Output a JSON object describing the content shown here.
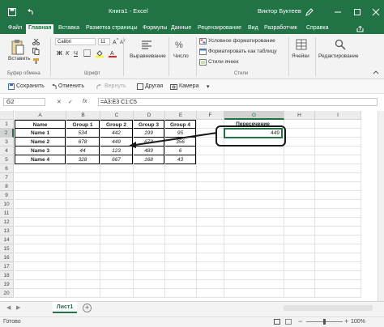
{
  "titlebar": {
    "autosave_icon": "save-icon",
    "undo_icon": "undo-icon",
    "title": "Книга1  -  Excel",
    "user": "Виктор Буктеев",
    "controls": [
      "—",
      "☐",
      "✕"
    ]
  },
  "menu": {
    "tabs": [
      "Файл",
      "Главная",
      "Вставка",
      "Разметка страницы",
      "Формулы",
      "Данные",
      "Рецензирование",
      "Вид",
      "Разработчик",
      "Справка"
    ],
    "active": "Главная"
  },
  "ribbon": {
    "paste": "Вставить",
    "font_name": "Calibri",
    "font_size": "11",
    "bold": "Ж",
    "italic": "К",
    "underline": "Ч",
    "alignment": "Выравнивание",
    "number": "Число",
    "cond_format": "Условное форматирование",
    "format_table": "Форматировать как таблицу",
    "cell_styles": "Стили ячеек",
    "cells": "Ячейки",
    "editing": "Редактирование",
    "groups": {
      "clipboard": "Буфер обмена",
      "font": "Шрифт",
      "styles": "Стили"
    }
  },
  "quick_access": {
    "save": "Сохранить",
    "undo": "Отменить",
    "redo": "Вернуть",
    "other": "Другая",
    "camera": "Камера"
  },
  "formula_bar": {
    "name_box": "G2",
    "fx": "fx",
    "formula": "=A3:E3 C1:C5"
  },
  "grid": {
    "columns": [
      "A",
      "B",
      "C",
      "D",
      "E",
      "F",
      "G",
      "H",
      "I"
    ],
    "rows": [
      "1",
      "2",
      "3",
      "4",
      "5",
      "6",
      "7",
      "8",
      "9",
      "10",
      "11",
      "12",
      "13",
      "14",
      "15",
      "16",
      "17",
      "18",
      "19",
      "20"
    ],
    "table": {
      "headers": [
        "Name",
        "Group 1",
        "Group 2",
        "Group 3",
        "Group 4"
      ],
      "rows": [
        [
          "Name 1",
          "534",
          "442",
          "199",
          "95"
        ],
        [
          "Name 2",
          "678",
          "449",
          "673",
          "356"
        ],
        [
          "Name 3",
          "44",
          "123",
          "489",
          "6"
        ],
        [
          "Name 4",
          "328",
          "667",
          "168",
          "43"
        ]
      ]
    },
    "g1": "Пересечение",
    "g2": "449"
  },
  "sheets": {
    "active": "Лист1",
    "add": "+"
  },
  "status": {
    "text": "Готово",
    "zoom": "100%"
  },
  "colors": {
    "accent": "#217346"
  }
}
